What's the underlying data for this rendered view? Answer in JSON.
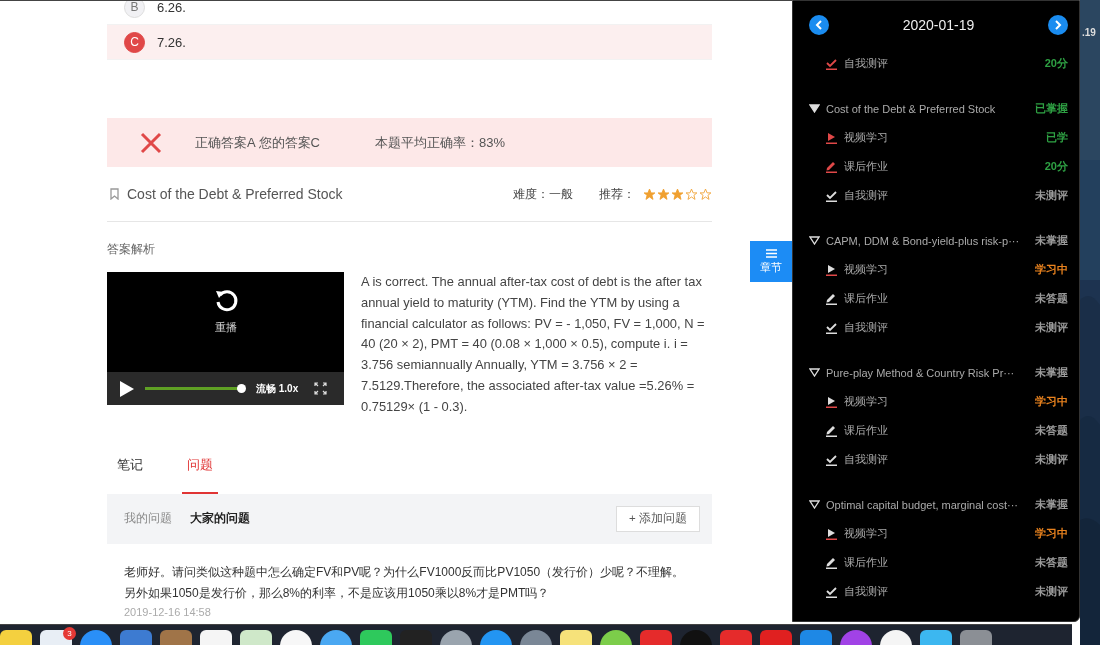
{
  "options": [
    {
      "letter": "B",
      "text": "6.26.",
      "selected": false
    },
    {
      "letter": "C",
      "text": "7.26.",
      "selected": true
    }
  ],
  "result": {
    "correct": false,
    "answer_text": "正确答案A 您的答案C",
    "average_text": "本题平均正确率：83%"
  },
  "topic": {
    "title": "Cost of the Debt & Preferred Stock",
    "difficulty": "难度：一般",
    "recommend_label": "推荐：",
    "stars": 3
  },
  "analysis": {
    "heading": "答案解析",
    "video": {
      "replay_label": "重播",
      "level": 1,
      "speed": "流畅 1.0x"
    },
    "text": "A is correct. The annual after-tax cost of debt is the after tax annual yield to maturity (YTM). Find the YTM by using a financial calculator as follows: PV = - 1,050, FV = 1,000, N = 40 (20 × 2), PMT = 40 (0.08 × 1,000 × 0.5), compute i. i = 3.756 semiannually Annually, YTM = 3.756 × 2 = 7.5129.Therefore, the associated after-tax value =5.26% = 0.75129× (1 - 0.3)."
  },
  "tabs": [
    {
      "label": "笔记",
      "selected": false
    },
    {
      "label": "问题",
      "selected": true
    }
  ],
  "question_filters": [
    {
      "label": "我的问题",
      "selected": false
    },
    {
      "label": "大家的问题",
      "selected": true
    }
  ],
  "add_question_button": "+ 添加问题",
  "question": {
    "text": "老师好。请问类似这种题中怎么确定FV和PV呢？为什么FV1000反而比PV1050（发行价）少呢？不理解。另外如果1050是发行价，那么8%的利率，不是应该用1050乘以8%才是PMT吗？",
    "time": "2019-12-16 14:58"
  },
  "chapter_button": "章节",
  "sidebar": {
    "date": "2020-01-19",
    "leading_items": [
      {
        "kind": "test",
        "label": "自我测评",
        "status": "20分",
        "color": "#2ea043",
        "done": true
      }
    ],
    "sections": [
      {
        "title": "Cost of the Debt & Preferred Stock",
        "status": "已掌握",
        "color": "#2ea043",
        "selected": true,
        "items": [
          {
            "kind": "video",
            "label": "视频学习",
            "status": "已学",
            "color": "#2ea043",
            "done": true
          },
          {
            "kind": "homework",
            "label": "课后作业",
            "status": "20分",
            "color": "#2ea043",
            "done": true
          },
          {
            "kind": "test",
            "label": "自我测评",
            "status": "未测评",
            "color": "#9a9a9a",
            "done": false
          }
        ]
      },
      {
        "title": "CAPM, DDM & Bond-yield-plus risk-p···",
        "status": "未掌握",
        "color": "#9a9a9a",
        "selected": false,
        "items": [
          {
            "kind": "video",
            "label": "视频学习",
            "status": "学习中",
            "color": "#e8821e",
            "done": false
          },
          {
            "kind": "homework",
            "label": "课后作业",
            "status": "未答题",
            "color": "#9a9a9a",
            "done": false
          },
          {
            "kind": "test",
            "label": "自我测评",
            "status": "未测评",
            "color": "#9a9a9a",
            "done": false
          }
        ]
      },
      {
        "title": "Pure-play Method & Country Risk Pr···",
        "status": "未掌握",
        "color": "#9a9a9a",
        "selected": false,
        "items": [
          {
            "kind": "video",
            "label": "视频学习",
            "status": "学习中",
            "color": "#e8821e",
            "done": false
          },
          {
            "kind": "homework",
            "label": "课后作业",
            "status": "未答题",
            "color": "#9a9a9a",
            "done": false
          },
          {
            "kind": "test",
            "label": "自我测评",
            "status": "未测评",
            "color": "#9a9a9a",
            "done": false
          }
        ]
      },
      {
        "title": "Optimal capital budget, marginal cost···",
        "status": "未掌握",
        "color": "#9a9a9a",
        "selected": false,
        "items": [
          {
            "kind": "video",
            "label": "视频学习",
            "status": "学习中",
            "color": "#e8821e",
            "done": false
          },
          {
            "kind": "homework",
            "label": "课后作业",
            "status": "未答题",
            "color": "#9a9a9a",
            "done": false
          },
          {
            "kind": "test",
            "label": "自我测评",
            "status": "未测评",
            "color": "#9a9a9a",
            "done": false
          }
        ]
      }
    ]
  },
  "desktop_text": ".19",
  "dock": {
    "badge": "3"
  }
}
